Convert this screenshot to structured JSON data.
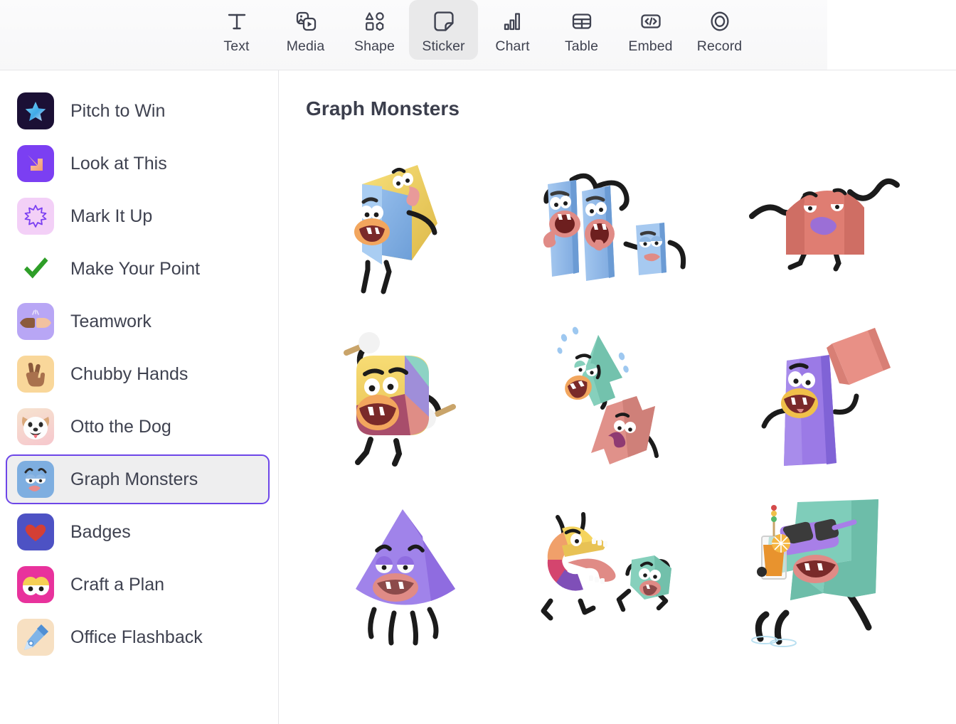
{
  "toolbar": {
    "items": [
      {
        "label": "Text",
        "icon": "text-icon",
        "active": false
      },
      {
        "label": "Media",
        "icon": "media-icon",
        "active": false
      },
      {
        "label": "Shape",
        "icon": "shape-icon",
        "active": false
      },
      {
        "label": "Sticker",
        "icon": "sticker-icon",
        "active": true
      },
      {
        "label": "Chart",
        "icon": "chart-icon",
        "active": false
      },
      {
        "label": "Table",
        "icon": "table-icon",
        "active": false
      },
      {
        "label": "Embed",
        "icon": "embed-icon",
        "active": false
      },
      {
        "label": "Record",
        "icon": "record-icon",
        "active": false
      }
    ]
  },
  "sidebar": {
    "items": [
      {
        "label": "Pitch to Win",
        "icon": "star-sticker-thumb",
        "selected": false
      },
      {
        "label": "Look at This",
        "icon": "down-arrow-hand-thumb",
        "selected": false
      },
      {
        "label": "Mark It Up",
        "icon": "burst-outline-thumb",
        "selected": false
      },
      {
        "label": "Make Your Point",
        "icon": "green-check-thumb",
        "selected": false
      },
      {
        "label": "Teamwork",
        "icon": "fist-bump-thumb",
        "selected": false
      },
      {
        "label": "Chubby Hands",
        "icon": "peace-hand-thumb",
        "selected": false
      },
      {
        "label": "Otto the Dog",
        "icon": "dog-face-thumb",
        "selected": false
      },
      {
        "label": "Graph Monsters",
        "icon": "blue-monster-face-thumb",
        "selected": true
      },
      {
        "label": "Badges",
        "icon": "heart-thumb",
        "selected": false
      },
      {
        "label": "Craft a Plan",
        "icon": "googly-eyes-thumb",
        "selected": false
      },
      {
        "label": "Office Flashback",
        "icon": "pen-nib-thumb",
        "selected": false
      }
    ]
  },
  "main": {
    "title": "Graph Monsters",
    "stickers": [
      {
        "name": "pie-slice-monster-sticker",
        "alt": "Yellow and blue pie-slice monster with big smile"
      },
      {
        "name": "screaming-bars-monster-sticker",
        "alt": "Three blue bar monsters screaming"
      },
      {
        "name": "red-area-chart-monster-sticker",
        "alt": "Red area-chart monster with purple smirk"
      },
      {
        "name": "drummer-pie-monster-sticker",
        "alt": "Multicolor pie monster playing drums"
      },
      {
        "name": "up-down-arrow-monsters-sticker",
        "alt": "Green up arrow and red down arrow monsters"
      },
      {
        "name": "purple-bar-lifting-monster-sticker",
        "alt": "Purple bar monster lifting a red bar"
      },
      {
        "name": "sad-cone-monster-sticker",
        "alt": "Sad purple cone monster"
      },
      {
        "name": "donut-chasing-cube-sticker",
        "alt": "Donut chart monster chasing a small green cube"
      },
      {
        "name": "relaxing-arrow-monster-sticker",
        "alt": "Green arrow monster with sunglasses and drink"
      }
    ]
  },
  "colors": {
    "accent": "#6d46e8",
    "selected_bg": "#eeeeef",
    "toolbar_active_bg": "#e9e9ea",
    "text": "#3f4250",
    "title": "#3b3e4c",
    "divider": "#e6e6e8"
  }
}
